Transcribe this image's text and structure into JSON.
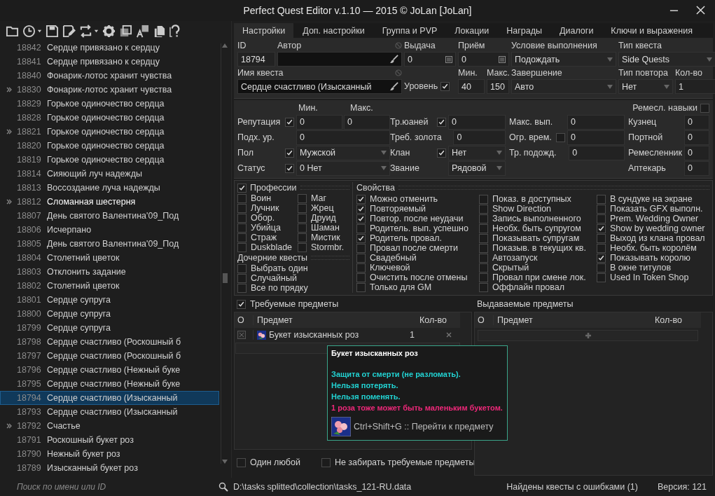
{
  "window": {
    "title": "Perfect Quest Editor v.1.10 — 2015 © JoLan [JoLan]"
  },
  "quest_list": {
    "items": [
      {
        "id": "18842",
        "name": "Сердце привязано к сердцу",
        "expandable": false,
        "emphasized": false,
        "selected": false
      },
      {
        "id": "18841",
        "name": "Сердце привязано к сердцу",
        "expandable": false,
        "emphasized": false,
        "selected": false
      },
      {
        "id": "18840",
        "name": "Фонарик-лотос хранит чувства",
        "expandable": false,
        "emphasized": false,
        "selected": false
      },
      {
        "id": "18830",
        "name": "Фонарик-лотос хранит чувства",
        "expandable": true,
        "emphasized": false,
        "selected": false
      },
      {
        "id": "18829",
        "name": "Горькое одиночество сердца",
        "expandable": false,
        "emphasized": false,
        "selected": false
      },
      {
        "id": "18828",
        "name": "Горькое одиночество сердца",
        "expandable": false,
        "emphasized": false,
        "selected": false
      },
      {
        "id": "18821",
        "name": "Горькое одиночество сердца",
        "expandable": true,
        "emphasized": false,
        "selected": false
      },
      {
        "id": "18820",
        "name": "Горькое одиночество сердца",
        "expandable": false,
        "emphasized": false,
        "selected": false
      },
      {
        "id": "18819",
        "name": "Горькое одиночество сердца",
        "expandable": false,
        "emphasized": false,
        "selected": false
      },
      {
        "id": "18814",
        "name": "Сияющий луч надежды",
        "expandable": false,
        "emphasized": false,
        "selected": false
      },
      {
        "id": "18813",
        "name": "Воссоздание луча надежды",
        "expandable": false,
        "emphasized": false,
        "selected": false
      },
      {
        "id": "18812",
        "name": "Сломанная шестерня",
        "expandable": true,
        "emphasized": true,
        "selected": false
      },
      {
        "id": "18807",
        "name": "День святого Валентина'09_Под",
        "expandable": false,
        "emphasized": false,
        "selected": false
      },
      {
        "id": "18806",
        "name": "Исчерпано",
        "expandable": false,
        "emphasized": false,
        "selected": false
      },
      {
        "id": "18805",
        "name": "День святого Валентина'09_Под",
        "expandable": false,
        "emphasized": false,
        "selected": false
      },
      {
        "id": "18804",
        "name": "Столетний цветок",
        "expandable": false,
        "emphasized": false,
        "selected": false
      },
      {
        "id": "18803",
        "name": "Отклонить задание",
        "expandable": false,
        "emphasized": false,
        "selected": false
      },
      {
        "id": "18802",
        "name": "Столетний цветок",
        "expandable": false,
        "emphasized": false,
        "selected": false
      },
      {
        "id": "18801",
        "name": "Сердце супруга",
        "expandable": false,
        "emphasized": false,
        "selected": false
      },
      {
        "id": "18800",
        "name": "Сердце супруга",
        "expandable": false,
        "emphasized": false,
        "selected": false
      },
      {
        "id": "18799",
        "name": "Сердце супруга",
        "expandable": false,
        "emphasized": false,
        "selected": false
      },
      {
        "id": "18798",
        "name": "Сердце счастливо (Роскошный б",
        "expandable": false,
        "emphasized": false,
        "selected": false
      },
      {
        "id": "18797",
        "name": "Сердце счастливо (Роскошный б",
        "expandable": false,
        "emphasized": false,
        "selected": false
      },
      {
        "id": "18796",
        "name": "Сердце счастливо (Нежный буке",
        "expandable": false,
        "emphasized": false,
        "selected": false
      },
      {
        "id": "18795",
        "name": "Сердце счастливо (Нежный буке",
        "expandable": false,
        "emphasized": false,
        "selected": false
      },
      {
        "id": "18794",
        "name": "Сердце счастливо (Изысканный",
        "expandable": false,
        "emphasized": false,
        "selected": true
      },
      {
        "id": "18793",
        "name": "Сердце счастливо (Изысканный",
        "expandable": false,
        "emphasized": false,
        "selected": false
      },
      {
        "id": "18792",
        "name": "Счастье",
        "expandable": true,
        "emphasized": false,
        "selected": false
      },
      {
        "id": "18791",
        "name": "Роскошный букет роз",
        "expandable": false,
        "emphasized": false,
        "selected": false
      },
      {
        "id": "18790",
        "name": "Нежный букет роз",
        "expandable": false,
        "emphasized": false,
        "selected": false
      },
      {
        "id": "18789",
        "name": "Изысканный букет роз",
        "expandable": false,
        "emphasized": false,
        "selected": false
      }
    ],
    "search": {
      "placeholder": "Поиск по имени или ID"
    }
  },
  "tabs": [
    {
      "label": "Настройки",
      "selected": true
    },
    {
      "label": "Доп. настройки",
      "selected": false
    },
    {
      "label": "Группа и PVP",
      "selected": false
    },
    {
      "label": "Локации",
      "selected": false
    },
    {
      "label": "Награды",
      "selected": false
    },
    {
      "label": "Диалоги",
      "selected": false
    },
    {
      "label": "Ключи и выражения",
      "selected": false
    }
  ],
  "main": {
    "id": {
      "label": "ID",
      "value": "18794"
    },
    "author": {
      "label": "Автор"
    },
    "give": {
      "label": "Выдача",
      "value": "0"
    },
    "receive": {
      "label": "Приём",
      "value": "0"
    },
    "condition": {
      "label": "Условие выполнения",
      "value": "Подождать"
    },
    "quest_type": {
      "label": "Тип квеста",
      "value": "Side Quests"
    },
    "name": {
      "label": "Имя квеста",
      "value": "Сердце счастливо (Изысканный"
    },
    "level": {
      "label": "Уровень",
      "checked": true,
      "min_label": "Мин.",
      "min": "40",
      "max_label": "Макс.",
      "max": "150"
    },
    "finish": {
      "label": "Завершение",
      "value": "Авто"
    },
    "repeat_type": {
      "label": "Тип повтора",
      "value": "Нет"
    },
    "count": {
      "label": "Кол-во",
      "value": "1"
    }
  },
  "conditions": {
    "header": {
      "min": "Мин.",
      "max": "Макс."
    },
    "skills": {
      "label": "Ремесл. навыки",
      "checked": false
    },
    "columns": [
      [
        {
          "kind": "range",
          "label": "Репутация",
          "checked": true,
          "min": "0",
          "max": "0"
        },
        {
          "kind": "field",
          "label": "Подх. ур.",
          "value": "0"
        },
        {
          "kind": "dropdown",
          "label": "Пол",
          "checked": true,
          "value": "Мужской"
        },
        {
          "kind": "dropdown",
          "label": "Статус",
          "checked": true,
          "value": "0 Нет"
        }
      ],
      [
        {
          "kind": "field",
          "label": "Тр.юаней",
          "checked": true,
          "value": "0"
        },
        {
          "kind": "field",
          "label": "Треб. золота",
          "value": "0"
        },
        {
          "kind": "dropdown",
          "label": "Клан",
          "checked": true,
          "value": "Нет"
        },
        {
          "kind": "dropdown",
          "label": "Звание",
          "value": "Рядовой"
        }
      ],
      [
        {
          "kind": "field",
          "label": "Макс. вып.",
          "value": "0"
        },
        {
          "kind": "field",
          "label": "Огр. врем.",
          "checked": false,
          "value": "0"
        },
        {
          "kind": "field",
          "label": "Тр. подожд.",
          "value": "0"
        }
      ],
      [
        {
          "kind": "field",
          "label": "Кузнец",
          "value": "0"
        },
        {
          "kind": "field",
          "label": "Портной",
          "value": "0"
        },
        {
          "kind": "field",
          "label": "Ремесленник",
          "value": "0"
        },
        {
          "kind": "field",
          "label": "Аптекарь",
          "value": "0"
        }
      ]
    ]
  },
  "professions": {
    "label": "Профессии",
    "checked": true,
    "items": [
      {
        "label": "Воин",
        "checked": false
      },
      {
        "label": "Маг",
        "checked": false
      },
      {
        "label": "Лучник",
        "checked": false
      },
      {
        "label": "Жрец",
        "checked": false
      },
      {
        "label": "Обор.",
        "checked": false
      },
      {
        "label": "Друид",
        "checked": false
      },
      {
        "label": "Убийца",
        "checked": false
      },
      {
        "label": "Шаман",
        "checked": false
      },
      {
        "label": "Страж",
        "checked": false
      },
      {
        "label": "Мистик",
        "checked": false
      },
      {
        "label": "Duskblade",
        "checked": false
      },
      {
        "label": "Stormbr.",
        "checked": false
      }
    ]
  },
  "child_quests": {
    "title": "Дочерние квесты",
    "options": [
      {
        "label": "Выбрать один",
        "checked": false
      },
      {
        "label": "Случайный",
        "checked": false
      },
      {
        "label": "Все по прядку",
        "checked": false
      }
    ]
  },
  "properties": {
    "title": "Свойства",
    "columns": [
      [
        {
          "label": "Можно отменить",
          "checked": true
        },
        {
          "label": "Повторяемый",
          "checked": true
        },
        {
          "label": "Повтор. после неудачи",
          "checked": true
        },
        {
          "label": "Родитель. вып. успешно",
          "checked": false
        },
        {
          "label": "Родитель провал.",
          "checked": true
        },
        {
          "label": "Провал после смерти",
          "checked": false
        },
        {
          "label": "Свадебный",
          "checked": false
        },
        {
          "label": "Ключевой",
          "checked": false
        },
        {
          "label": "Очистить после отмены",
          "checked": false
        },
        {
          "label": "Только для GM",
          "checked": false
        }
      ],
      [
        {
          "label": "Показ. в доступных",
          "checked": false
        },
        {
          "label": "Show Direction",
          "checked": false
        },
        {
          "label": "Запись выполненного",
          "checked": false
        },
        {
          "label": "Необх. быть супругом",
          "checked": false
        },
        {
          "label": "Показывать супругам",
          "checked": false
        },
        {
          "label": "Показыв. в текущих кв.",
          "checked": false
        },
        {
          "label": "Автозапуск",
          "checked": false
        },
        {
          "label": "Скрытый",
          "checked": false
        },
        {
          "label": "Провал при смене лок.",
          "checked": false
        },
        {
          "label": "Оффлайн провал",
          "checked": false
        }
      ],
      [
        {
          "label": "В сундуке на экране",
          "checked": false
        },
        {
          "label": "Показать GFX выполн.",
          "checked": false
        },
        {
          "label": "Prem. Wedding Owner",
          "checked": false
        },
        {
          "label": "Show by wedding owner",
          "checked": true
        },
        {
          "label": "Выход из клана провал",
          "checked": false
        },
        {
          "label": "Необх. быть королём",
          "checked": false
        },
        {
          "label": "Показывать королю",
          "checked": true
        },
        {
          "label": "В окне титулов",
          "checked": false
        },
        {
          "label": "Used In Token Shop",
          "checked": false
        }
      ]
    ]
  },
  "required_items": {
    "label": "Требуемые предметы",
    "checked": true,
    "columns": [
      "O",
      "Предмет",
      "Кол-во"
    ],
    "rows": [
      {
        "disabled": true,
        "name": "Букет изысканных роз",
        "count": "1"
      }
    ]
  },
  "issued_items": {
    "title": "Выдаваемые предметы",
    "columns": [
      "O",
      "Предмет",
      "Кол-во"
    ]
  },
  "options": [
    {
      "label": "Один любой",
      "checked": false
    },
    {
      "label": "Не забирать требуемые предметы",
      "checked": false
    }
  ],
  "tooltip": {
    "title": "Букет изысканных роз",
    "lines": [
      {
        "text": "Защита от смерти (не разломать).",
        "color": "#22d3d3"
      },
      {
        "text": "Нельзя потерять.",
        "color": "#22d3d3"
      },
      {
        "text": "Нельзя поменять.",
        "color": "#22d3d3"
      },
      {
        "text": "1 роза тоже может быть маленьким букетом.",
        "color": "#f0287a"
      }
    ],
    "hotkey": "Ctrl+Shift+G :: Перейти к предмету"
  },
  "status_bar": {
    "path": "D:\\tasks splitted\\collection\\tasks_121-RU.data",
    "errors": "Найдены квесты с ошибками (1)",
    "version": "Версия: 121"
  }
}
